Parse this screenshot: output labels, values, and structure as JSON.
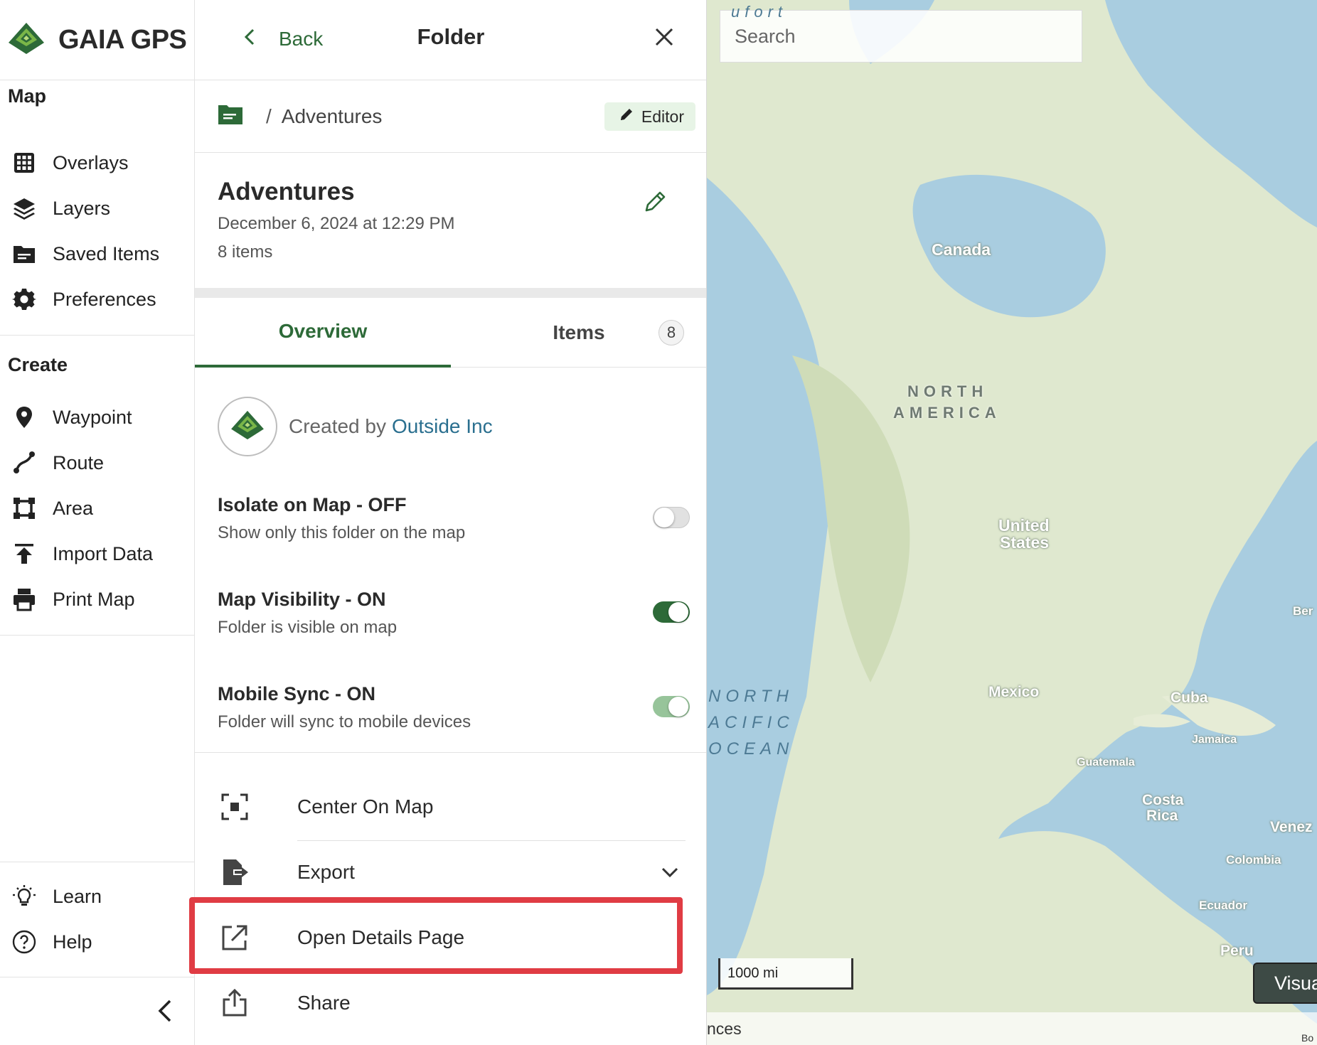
{
  "brand": {
    "name": "GAIA GPS",
    "icon": "gaia-logo-icon",
    "accent": "#2d6a38"
  },
  "nav": {
    "map_heading": "Map",
    "map_items": [
      {
        "label": "Overlays",
        "icon": "overlays-grid-icon"
      },
      {
        "label": "Layers",
        "icon": "layers-icon"
      },
      {
        "label": "Saved Items",
        "icon": "folder-icon"
      },
      {
        "label": "Preferences",
        "icon": "gear-icon"
      }
    ],
    "create_heading": "Create",
    "create_items": [
      {
        "label": "Waypoint",
        "icon": "pin-icon"
      },
      {
        "label": "Route",
        "icon": "route-icon"
      },
      {
        "label": "Area",
        "icon": "area-icon"
      },
      {
        "label": "Import Data",
        "icon": "upload-icon"
      },
      {
        "label": "Print Map",
        "icon": "printer-icon"
      }
    ],
    "footer_items": [
      {
        "label": "Learn",
        "icon": "lightbulb-icon"
      },
      {
        "label": "Help",
        "icon": "question-icon"
      }
    ]
  },
  "panel": {
    "back_label": "Back",
    "title": "Folder",
    "breadcrumb": {
      "separator": "/",
      "current": "Adventures"
    },
    "role_badge": "Editor",
    "folder": {
      "name": "Adventures",
      "date": "December 6, 2024 at 12:29 PM",
      "count": "8 items"
    },
    "tabs": [
      {
        "label": "Overview",
        "active": true
      },
      {
        "label": "Items",
        "count": "8",
        "active": false
      }
    ],
    "creator": {
      "prefix": "Created by",
      "name": "Outside Inc"
    },
    "settings": [
      {
        "title": "Isolate on Map - OFF",
        "desc": "Show only this folder on the map",
        "state": "off"
      },
      {
        "title": "Map Visibility - ON",
        "desc": "Folder is visible on map",
        "state": "on"
      },
      {
        "title": "Mobile Sync - ON",
        "desc": "Folder will sync to mobile devices",
        "state": "on-muted"
      }
    ],
    "actions": [
      {
        "label": "Center On Map",
        "icon": "center-focus-icon"
      },
      {
        "label": "Export",
        "icon": "export-icon"
      },
      {
        "label": "Open Details Page",
        "icon": "external-link-icon"
      },
      {
        "label": "Share",
        "icon": "share-icon"
      }
    ]
  },
  "map": {
    "search_placeholder": "Search",
    "labels": {
      "canada": "Canada",
      "north": "NORTH",
      "america": "AMERICA",
      "us1": "United",
      "us2": "States",
      "mexico": "Mexico",
      "cuba": "Cuba",
      "jamaica": "Jamaica",
      "guatemala": "Guatemala",
      "costa1": "Costa",
      "costa2": "Rica",
      "venez": "Venez",
      "colombia": "Colombia",
      "ecuador": "Ecuador",
      "peru": "Peru",
      "ber": "Ber",
      "ocean1": "NORTH",
      "ocean2": "ACIFIC",
      "ocean3": "OCEAN",
      "beaufort": "ufort"
    },
    "scale": "1000 mi",
    "visual_btn": "Visua",
    "attribution": "nces",
    "corner_text": "Bo"
  },
  "colors": {
    "highlight": "#e03c44",
    "link": "#2a6f8f",
    "water": "#a9cde0",
    "land": "#dfe8cf"
  }
}
